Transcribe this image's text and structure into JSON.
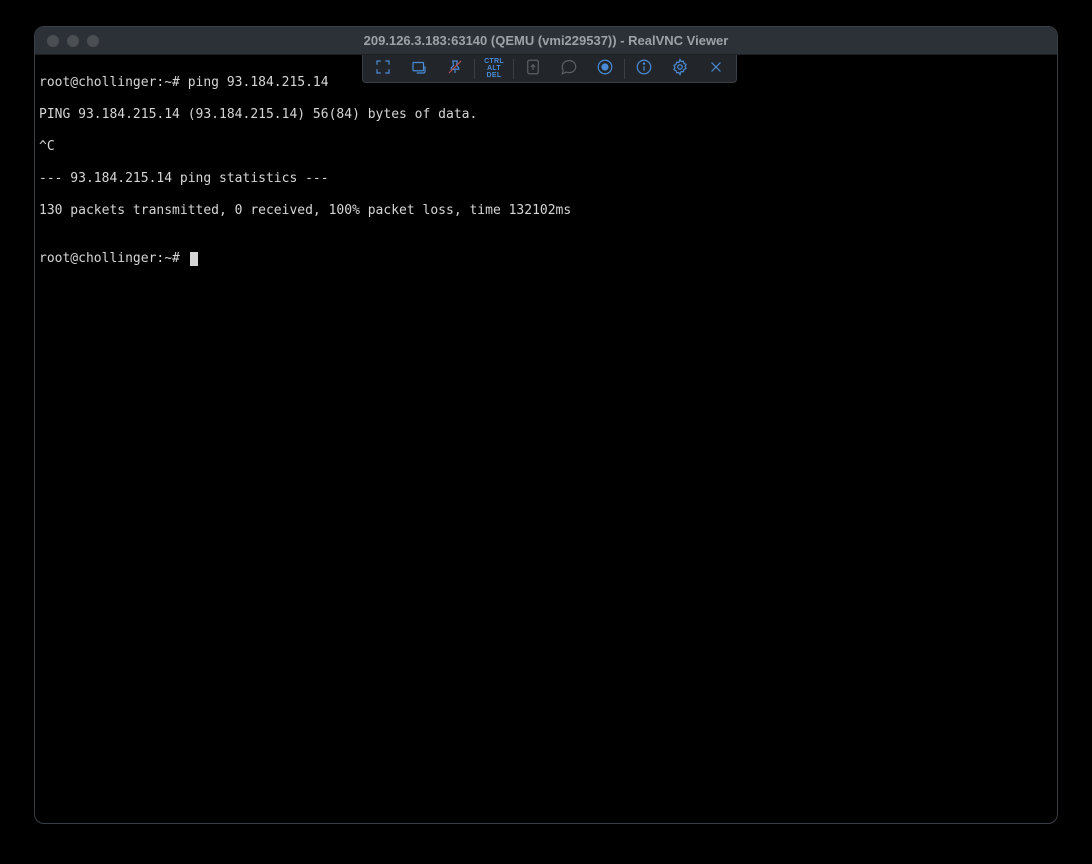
{
  "window": {
    "title": "209.126.3.183:63140 (QEMU (vmi229537)) - RealVNC Viewer"
  },
  "terminal": {
    "lines": [
      "root@chollinger:~# ping 93.184.215.14",
      "PING 93.184.215.14 (93.184.215.14) 56(84) bytes of data.",
      "^C",
      "--- 93.184.215.14 ping statistics ---",
      "130 packets transmitted, 0 received, 100% packet loss, time 132102ms",
      "",
      "root@chollinger:~# "
    ]
  },
  "toolbar": {
    "ctrl_alt_del": "CTRL\nALT\nDEL"
  }
}
